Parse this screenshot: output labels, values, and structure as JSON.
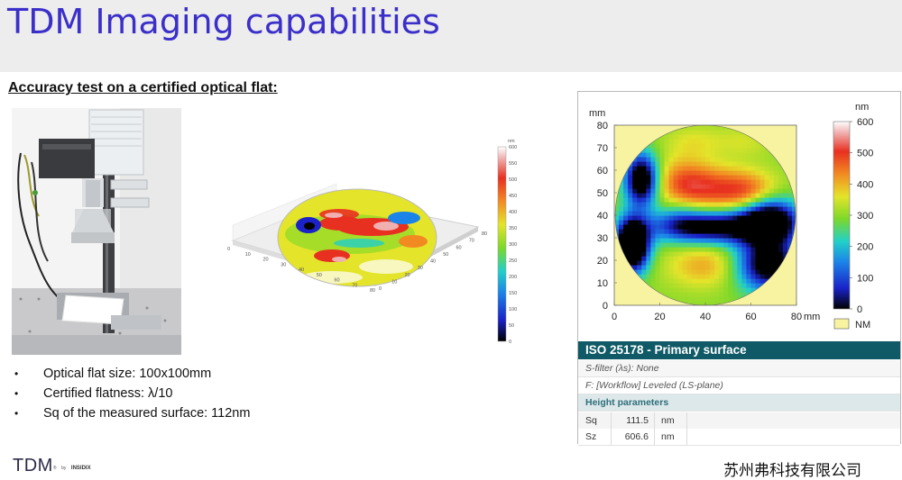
{
  "slide": {
    "title": "TDM Imaging capabilities",
    "subtitle": "Accuracy test on a certified optical flat:",
    "bullets": [
      "Optical flat size: 100x100mm",
      "Certified flatness: λ/10",
      "Sq of the measured surface: 112nm"
    ],
    "logo": {
      "main": "TDM",
      "mark": "®",
      "by": "by",
      "brand": "INSIDIX"
    },
    "company": "苏州弗科技有限公司"
  },
  "view3d": {
    "unit": "nm",
    "colorbar_ticks": [
      "600",
      "550",
      "500",
      "450",
      "400",
      "350",
      "300",
      "250",
      "200",
      "150",
      "100",
      "50",
      "0"
    ],
    "x_ticks": [
      "0",
      "10",
      "20",
      "30",
      "40",
      "50",
      "60",
      "70",
      "80"
    ],
    "y_ticks": [
      "0",
      "10",
      "20",
      "30",
      "40",
      "50",
      "60",
      "70",
      "80"
    ]
  },
  "panel": {
    "header": "ISO 25178 - Primary surface",
    "s_filter": "S-filter (λs): None",
    "f_filter": "F: [Workflow] Leveled (LS-plane)",
    "heading": "Height parameters",
    "params": [
      {
        "name": "Sq",
        "value": "111.5",
        "unit": "nm"
      },
      {
        "name": "Sz",
        "value": "606.6",
        "unit": "nm"
      }
    ]
  },
  "chart_data": {
    "type": "heatmap",
    "title": "",
    "xlabel": "mm",
    "ylabel": "mm",
    "colorbar_label": "nm",
    "xlim": [
      0,
      80
    ],
    "ylim": [
      0,
      80
    ],
    "x_ticks": [
      0,
      20,
      40,
      60,
      80
    ],
    "y_ticks": [
      0,
      10,
      20,
      30,
      40,
      50,
      60,
      70,
      80
    ],
    "colorbar_ticks": [
      0,
      100,
      200,
      300,
      400,
      500,
      600
    ],
    "colorbar_range": [
      0,
      600
    ],
    "legend": [
      {
        "name": "NM",
        "color": "#f7f3a0"
      }
    ],
    "colormap": [
      "#000000",
      "#1a22c8",
      "#1c84e8",
      "#22d0c8",
      "#7cd82a",
      "#e4e42a",
      "#f28a22",
      "#e83020",
      "#f0b0b0",
      "#ffffff"
    ],
    "nm_color": "#f7f3a0",
    "grid": false,
    "features": [
      {
        "x": 45,
        "y": 52,
        "sx": 13,
        "sy": 7,
        "value": 470
      },
      {
        "x": 30,
        "y": 55,
        "sx": 9,
        "sy": 8,
        "value": 440
      },
      {
        "x": 60,
        "y": 50,
        "sx": 9,
        "sy": 6,
        "value": 430
      },
      {
        "x": 35,
        "y": 73,
        "sx": 9,
        "sy": 5,
        "value": 360
      },
      {
        "x": 57,
        "y": 73,
        "sx": 9,
        "sy": 5,
        "value": 350
      },
      {
        "x": 8,
        "y": 27,
        "sx": 5,
        "sy": 8,
        "value": -300
      },
      {
        "x": 12,
        "y": 56,
        "sx": 5,
        "sy": 8,
        "value": -150
      },
      {
        "x": 68,
        "y": 38,
        "sx": 9,
        "sy": 7,
        "value": -140
      },
      {
        "x": 42,
        "y": 35,
        "sx": 17,
        "sy": 5,
        "value": -90
      },
      {
        "x": 68,
        "y": 18,
        "sx": 10,
        "sy": 8,
        "value": -100
      },
      {
        "x": 40,
        "y": 18,
        "sx": 12,
        "sy": 7,
        "value": 420
      },
      {
        "x": 58,
        "y": 28,
        "sx": 7,
        "sy": 6,
        "value": 280
      },
      {
        "x": 28,
        "y": 40,
        "sx": 7,
        "sy": 6,
        "value": 230
      }
    ],
    "base_value": 300
  }
}
